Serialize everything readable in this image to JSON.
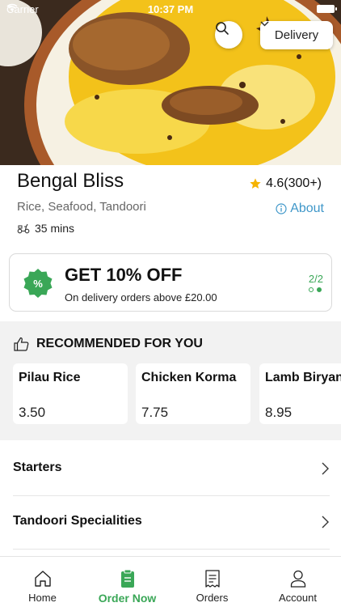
{
  "status_bar": {
    "carrier": "Carrier",
    "time": "10:37 PM"
  },
  "header": {
    "delivery_mode": "Delivery"
  },
  "restaurant": {
    "name": "Bengal Bliss",
    "rating": "4.6(300+)",
    "cuisine": "Rice, Seafood, Tandoori",
    "about_label": "About",
    "delivery_time": "35 mins"
  },
  "offer": {
    "title": "GET 10% OFF",
    "subtitle": "On delivery orders above £20.00",
    "page_indicator": "2/2"
  },
  "recommended": {
    "heading": "RECOMMENDED FOR YOU",
    "items": [
      {
        "name": "Pilau Rice",
        "price": "3.50"
      },
      {
        "name": "Chicken Korma",
        "price": "7.75"
      },
      {
        "name": "Lamb Biryani",
        "price": "8.95"
      }
    ]
  },
  "menu": {
    "categories": [
      {
        "label": "Starters"
      },
      {
        "label": "Tandoori Specialities"
      }
    ]
  },
  "tabbar": {
    "items": [
      {
        "label": "Home",
        "icon": "home-icon"
      },
      {
        "label": "Order Now",
        "icon": "order-icon"
      },
      {
        "label": "Orders",
        "icon": "receipt-icon"
      },
      {
        "label": "Account",
        "icon": "account-icon"
      }
    ]
  },
  "colors": {
    "accent_green": "#3aa757",
    "link_blue": "#3f97c9",
    "star": "#f5b301"
  }
}
